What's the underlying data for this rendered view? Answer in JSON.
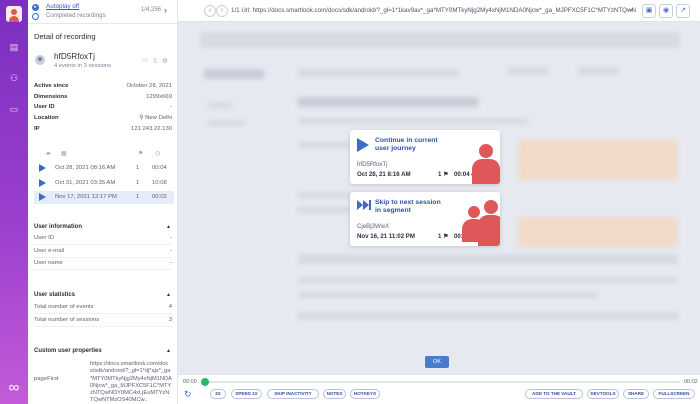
{
  "app": {
    "accent": "#3a6cc9",
    "rail_gradient": [
      "#7b2fc0",
      "#c35bd8"
    ]
  },
  "rail": {
    "icons": [
      "recordings-icon",
      "users-icon",
      "chat-icon"
    ],
    "bottom_icon": "infinity-logo-icon"
  },
  "topbar": {
    "autoplay_label": "Autoplay off",
    "completed_label": "Completed recordings",
    "counter": "1/4,256",
    "next_glyph": "›"
  },
  "detail": {
    "title": "Detail of recording",
    "user_name": "hfD5RfoxTj",
    "user_sub": "4 events in 3 sessions",
    "fields": [
      {
        "k": "Active since",
        "v": "October 28, 2021"
      },
      {
        "k": "Dimensions",
        "v": "1299x669"
      },
      {
        "k": "User ID",
        "v": "-"
      },
      {
        "k": "Location",
        "v": "New Delhi"
      },
      {
        "k": "IP",
        "v": "121.243.22.130"
      }
    ]
  },
  "sessions": [
    {
      "date": "Oct 28, 2021  08:16 AM",
      "events": "1",
      "time": "00:04"
    },
    {
      "date": "Oct 31, 2021  03:35 AM",
      "events": "1",
      "time": "10:08"
    },
    {
      "date": "Nov 17, 2021  12:17 PM",
      "events": "1",
      "time": "00:02"
    }
  ],
  "user_info": {
    "heading": "User information",
    "rows": [
      {
        "k": "User ID",
        "v": "-"
      },
      {
        "k": "User e-mail",
        "v": "-"
      },
      {
        "k": "User name",
        "v": "-"
      }
    ]
  },
  "user_stats": {
    "heading": "User statistics",
    "rows": [
      {
        "k": "Total number of events",
        "v": "4"
      },
      {
        "k": "Total number of sessions",
        "v": "3"
      }
    ]
  },
  "custom_props": {
    "heading": "Custom user properties",
    "key": "pageFirst",
    "value": "https://docs.smartlook.com/docs/sdk/android/?_gl=1*dj*ajs*_ga*MTY0MTkyNjg2My4xNjM1NDA0Njcw*_ga_MJPFXC5F1C*MTYzNTQwNDY0MC4xLjEuMTYzNTQwNTMzOS40MCw.."
  },
  "urlbar": {
    "back": "‹",
    "forward": "›",
    "url": "1/1 Url: https://docs.smartlook.com/docs/sdk/android/?_gl=1*1kav9av*_ga*MTY0MTkyNjg2My4xNjM1NDA0Njcw*_ga_MJPFXC5F1C*MTYzNTQwNDY3...",
    "chevron": "⌄"
  },
  "cards": {
    "continue": {
      "title_l1": "Continue in current",
      "title_l2": "user journey",
      "user_id": "hfD5RfoxTj",
      "date": "Oct 28, 21  8:16 AM",
      "events": "1",
      "time": "00:04"
    },
    "skip": {
      "title_l1": "Skip to next session",
      "title_l2": "in segment",
      "user_id": "CjeBj3WwX",
      "date": "Nov 16, 21  11:02 PM",
      "events": "1",
      "time": "00:06"
    }
  },
  "ok_label": "OK",
  "player": {
    "time_start": "00:00",
    "time_end": "00:02",
    "progress": 0.0,
    "buttons_left": [
      "2X",
      "SPEED 1X",
      "SKIP INACTIVITY",
      "NOTES",
      "HOTKEYS"
    ],
    "buttons_right": [
      "ADD TO THE VAULT",
      "DEVTOOLS",
      "SHARE",
      "FULLSCREEN"
    ]
  }
}
